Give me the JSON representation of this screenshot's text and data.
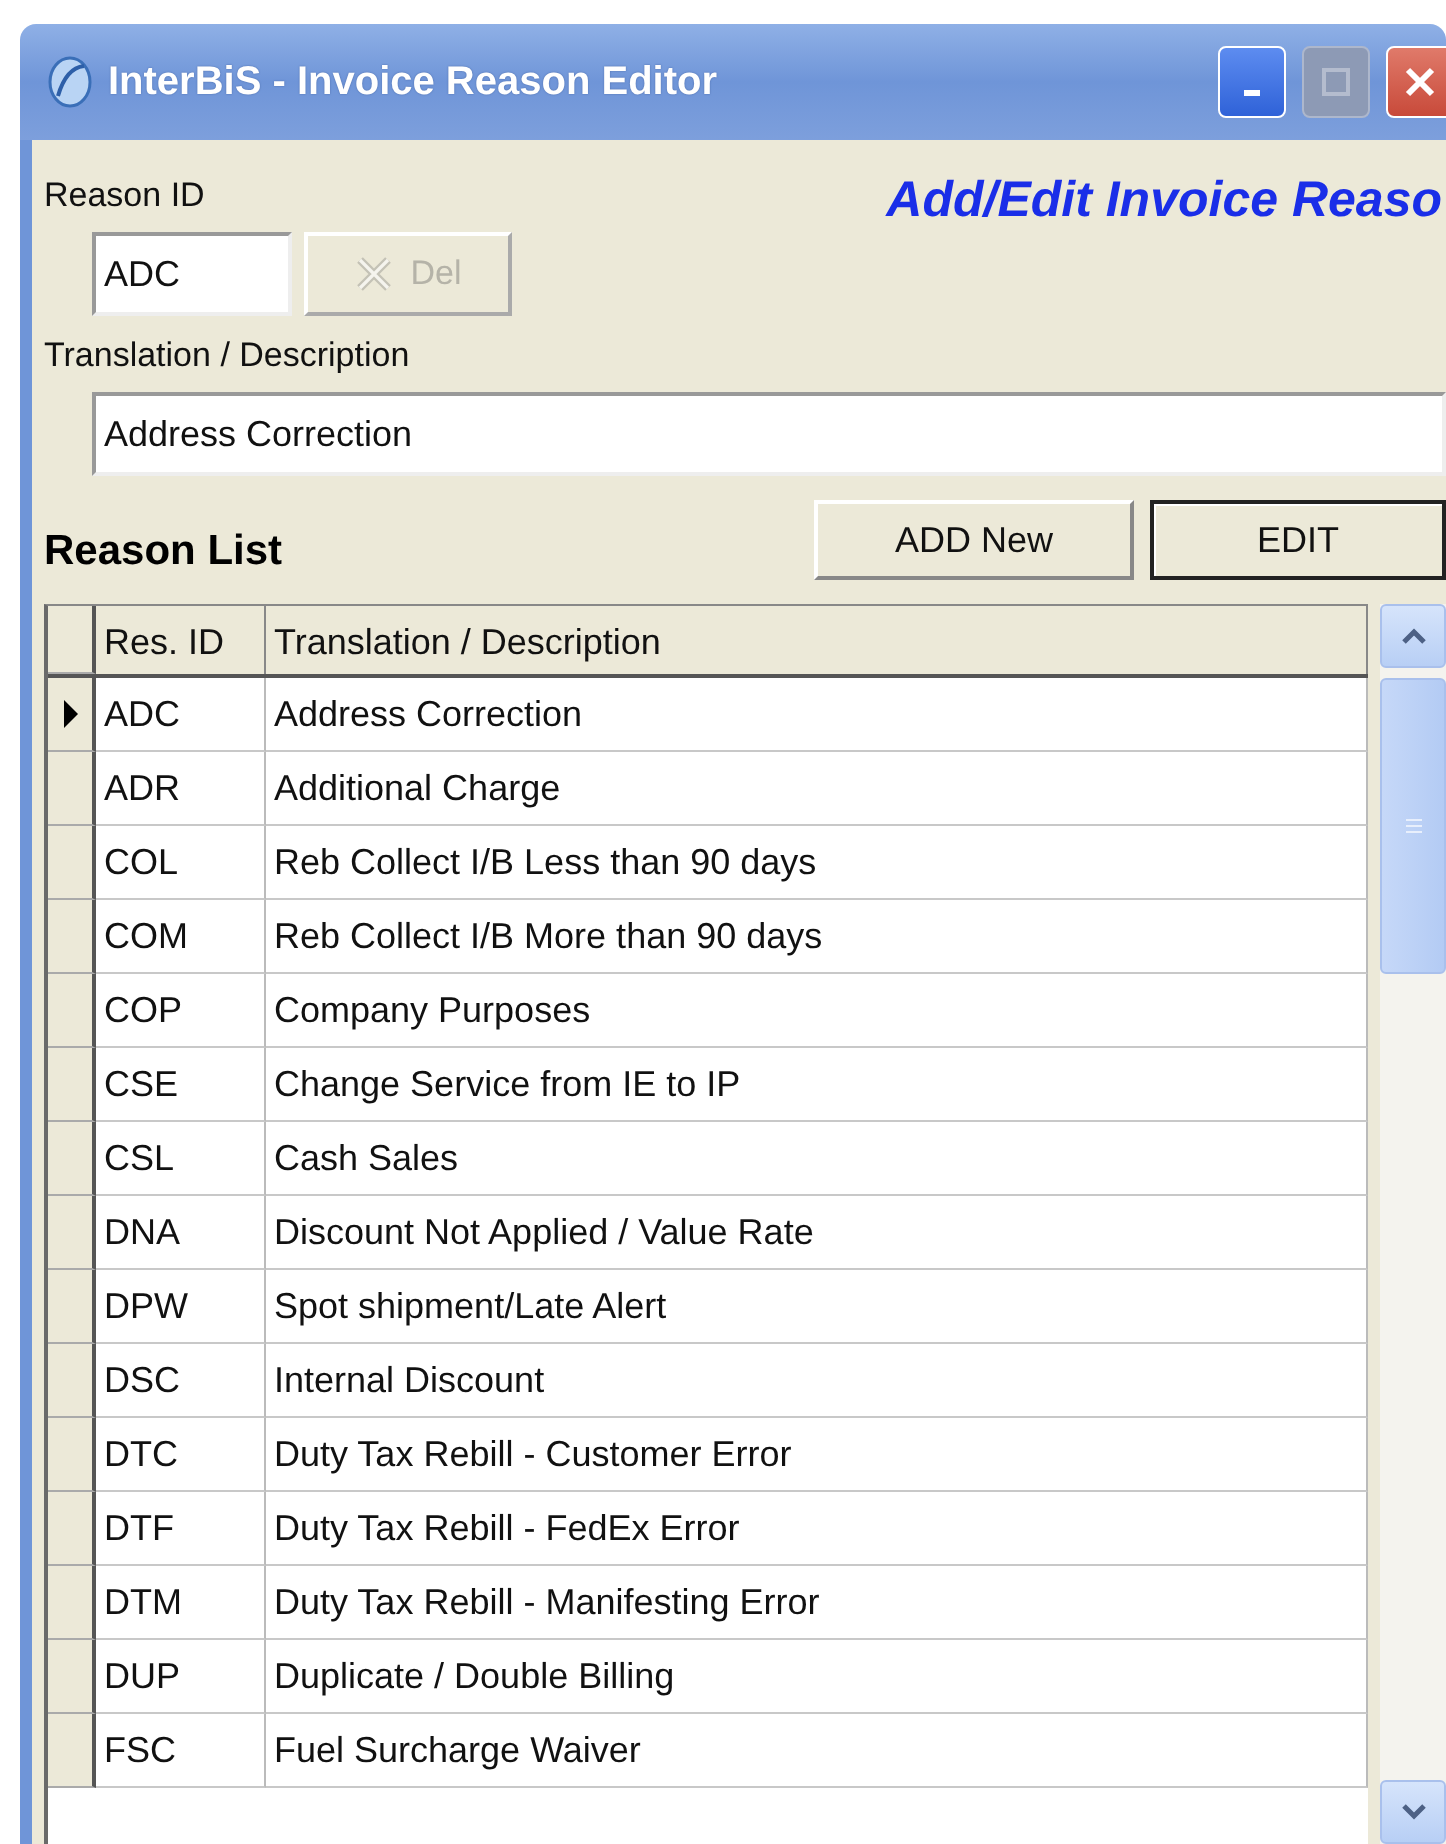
{
  "window": {
    "title": "InterBiS - Invoice Reason Editor",
    "controls": [
      {
        "kind": "minimize",
        "disabled": false
      },
      {
        "kind": "maximize",
        "disabled": true
      },
      {
        "kind": "close",
        "disabled": false
      }
    ]
  },
  "heading": "Add/Edit Invoice Reaso",
  "reason_id": {
    "label": "Reason ID",
    "value": "ADC"
  },
  "delete_button": {
    "label": "Del",
    "disabled": true
  },
  "description": {
    "label": "Translation / Description",
    "value": "Address Correction"
  },
  "list_title": "Reason List",
  "buttons": [
    {
      "label": "ADD New",
      "default": false
    },
    {
      "label": "EDIT",
      "default": true
    }
  ],
  "table": {
    "columns": [
      "Res. ID",
      "Translation / Description"
    ],
    "rows": [
      {
        "id": "ADC",
        "description": "Address Correction",
        "selected": true
      },
      {
        "id": "ADR",
        "description": "Additional Charge",
        "selected": false
      },
      {
        "id": "COL",
        "description": "Reb Collect I/B Less than 90 days",
        "selected": false
      },
      {
        "id": "COM",
        "description": "Reb Collect I/B More than 90 days",
        "selected": false
      },
      {
        "id": "COP",
        "description": "Company Purposes",
        "selected": false
      },
      {
        "id": "CSE",
        "description": "Change Service from IE to IP",
        "selected": false
      },
      {
        "id": "CSL",
        "description": "Cash Sales",
        "selected": false
      },
      {
        "id": "DNA",
        "description": "Discount Not Applied / Value Rate",
        "selected": false
      },
      {
        "id": "DPW",
        "description": "Spot shipment/Late Alert",
        "selected": false
      },
      {
        "id": "DSC",
        "description": "Internal Discount",
        "selected": false
      },
      {
        "id": "DTC",
        "description": "Duty Tax Rebill - Customer Error",
        "selected": false
      },
      {
        "id": "DTF",
        "description": "Duty Tax Rebill - FedEx Error",
        "selected": false
      },
      {
        "id": "DTM",
        "description": "Duty Tax Rebill - Manifesting Error",
        "selected": false
      },
      {
        "id": "DUP",
        "description": "Duplicate / Double Billing",
        "selected": false
      },
      {
        "id": "FSC",
        "description": "Fuel Surcharge Waiver",
        "selected": false
      }
    ]
  }
}
